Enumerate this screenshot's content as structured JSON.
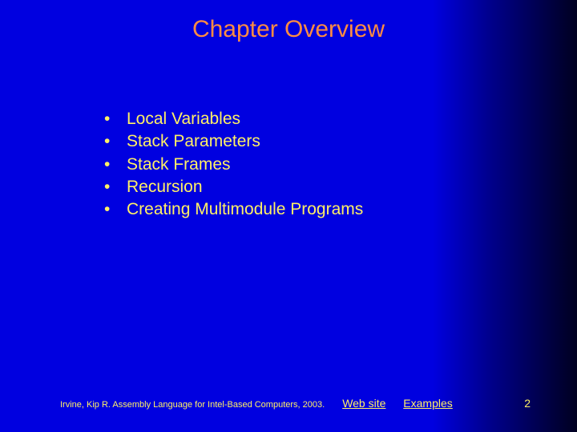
{
  "title": "Chapter Overview",
  "bullets": {
    "0": "Local Variables",
    "1": "Stack Parameters",
    "2": "Stack Frames",
    "3": "Recursion",
    "4": "Creating Multimodule Programs"
  },
  "footer": {
    "citation": "Irvine, Kip R. Assembly Language for Intel-Based Computers, 2003.",
    "link_web": "Web site",
    "link_examples": "Examples",
    "page_num": "2"
  }
}
